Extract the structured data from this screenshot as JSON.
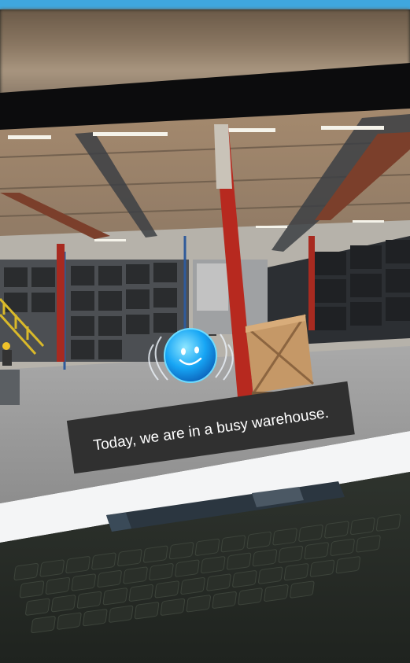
{
  "caption": {
    "text": "Today, we are in a busy warehouse."
  },
  "colors": {
    "top_bar": "#3fa7de",
    "mascot": "#1aa8f2",
    "caption_bg": "#303030",
    "pillar_red": "#b7291f"
  },
  "icons": {
    "mascot": "smiling-blue-orb-icon"
  }
}
